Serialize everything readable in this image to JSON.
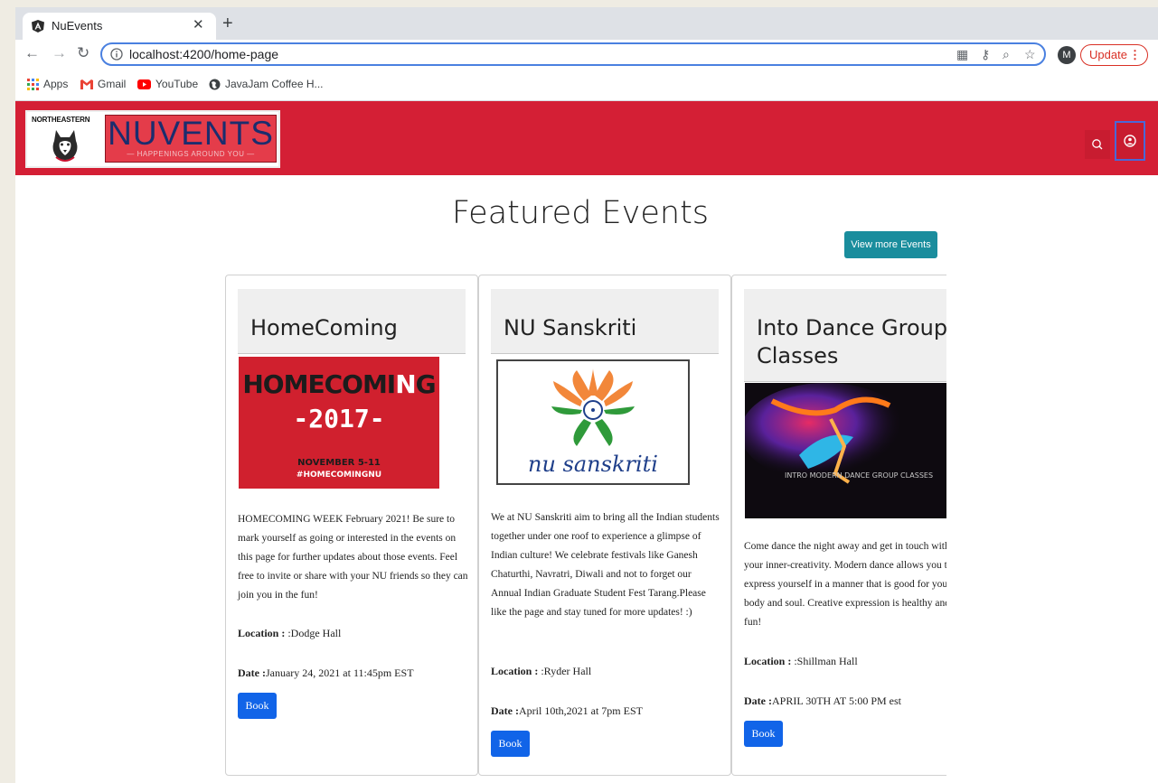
{
  "browser": {
    "tab_title": "NuEvents",
    "new_tab_glyph": "+",
    "close_glyph": "✕",
    "url_host": "localhost",
    "url_path": ":4200/home-page",
    "avatar_letter": "M",
    "update_label": "Update",
    "bookmarks": [
      "Apps",
      "Gmail",
      "YouTube",
      "JavaJam Coffee H..."
    ]
  },
  "header": {
    "logo_school": "NORTHEASTERN",
    "logo_title": "NUVENTS",
    "logo_tagline": "— HAPPENINGS AROUND YOU —",
    "brand_color": "#d41f35"
  },
  "main": {
    "title": "Featured Events",
    "view_more_label": "View more Events",
    "location_label": "Location :",
    "date_label": "Date :",
    "book_label": "Book"
  },
  "events": [
    {
      "title": "HomeComing",
      "image": {
        "line1": "HOMECOMI",
        "accent": "N",
        "line1b": "G",
        "line2": "-2017-",
        "line3": "NOVEMBER 5-11",
        "line4": "#HOMECOMINGNU"
      },
      "description": "HOMECOMING WEEK February 2021! Be sure to mark yourself as going or interested in the events on this page for further updates about those events. Feel free to invite or share with your NU friends so they can join you in the fun!",
      "location": ":Dodge Hall",
      "date": "January 24, 2021 at 11:45pm EST"
    },
    {
      "title": "NU Sanskriti",
      "image": {
        "text": "nu sanskriti"
      },
      "description": "We at NU Sanskriti aim to bring all the Indian students together under one roof to experience a glimpse of Indian culture! We celebrate festivals like Ganesh Chaturthi, Navratri, Diwali and not to forget our Annual Indian Graduate Student Fest Tarang.Please like the page and stay tuned for more updates! :)",
      "location": ":Ryder Hall",
      "date": "April 10th,2021 at 7pm EST"
    },
    {
      "title": "Into Dance Group Classes",
      "image": {
        "text": "INTRO MODERN DANCE GROUP CLASSES"
      },
      "description": "Come dance the night away and get in touch with your inner-creativity. Modern dance allows you to express yourself in a manner that is good for your body and soul. Creative expression is healthy and fun!",
      "location": ":Shillman Hall",
      "date": "APRIL 30TH AT 5:00 PM est"
    }
  ]
}
